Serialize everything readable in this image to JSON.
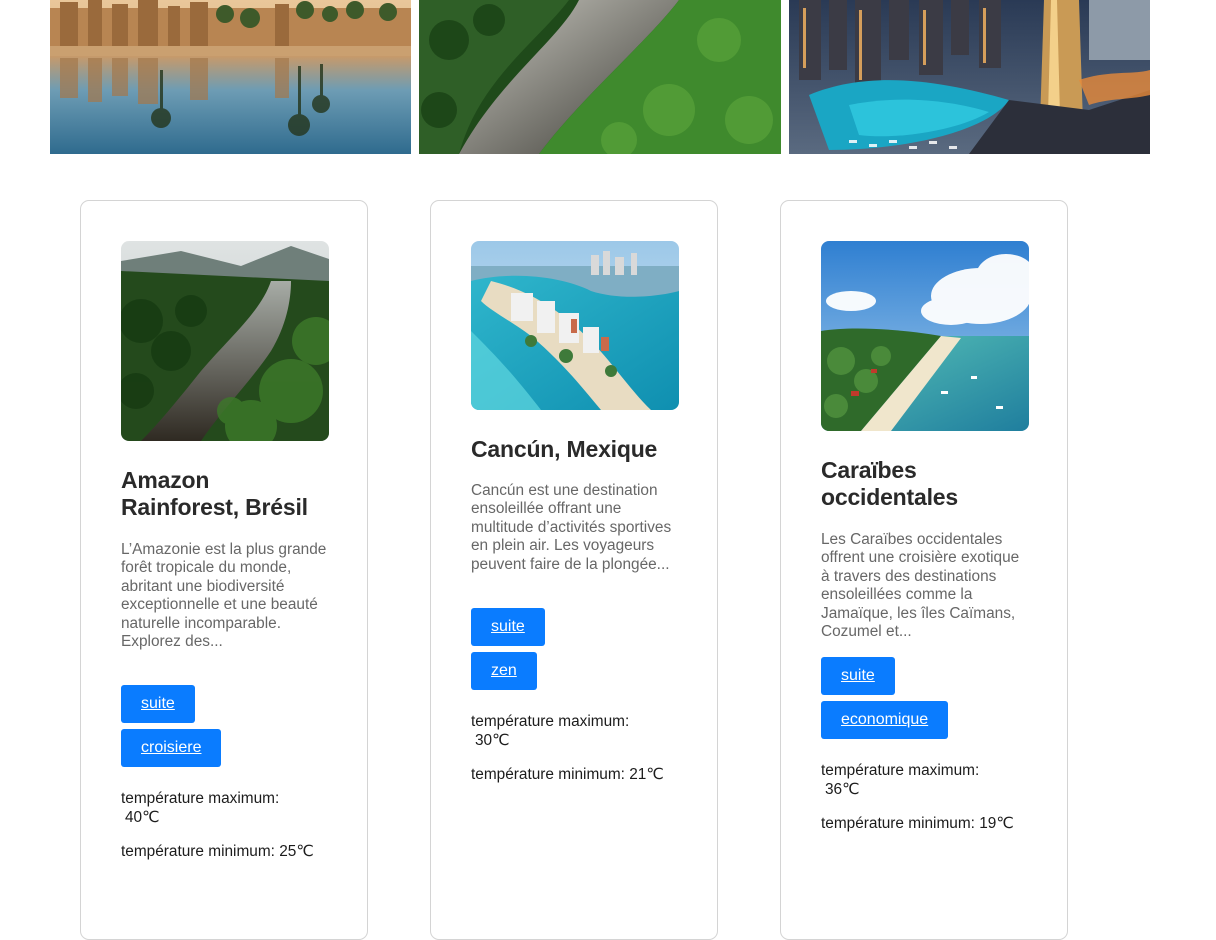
{
  "gallery": [
    {
      "name": "Karnak temple reflection"
    },
    {
      "name": "Amazon river aerial"
    },
    {
      "name": "Dubai marina night"
    }
  ],
  "cards": [
    {
      "title": "Amazon Rainforest, Brésil",
      "description": "L’Amazonie est la plus grande forêt tropicale du monde, abritant une biodiversité exceptionnelle et une beauté naturelle incomparable. Explorez des...",
      "buttons": [
        "suite",
        "croisiere"
      ],
      "temp_max_label": "température maximum:",
      "temp_max_value": "40℃",
      "temp_min": "température minimum: 25℃"
    },
    {
      "title": "Cancún, Mexique",
      "description": "Cancún est une destination ensoleillée offrant une multitude d’activités sportives en plein air. Les voyageurs peuvent faire de la plongée...",
      "buttons": [
        "suite",
        "zen"
      ],
      "temp_max_label": "température maximum:",
      "temp_max_value": "30℃",
      "temp_min": "température minimum: 21℃"
    },
    {
      "title": "Caraïbes occidentales",
      "description": "Les Caraïbes occidentales offrent une croisière exotique à travers des destinations ensoleillées comme la Jamaïque, les îles Caïmans, Cozumel et...",
      "buttons": [
        "suite",
        "economique"
      ],
      "temp_max_label": "température maximum:",
      "temp_max_value": "36℃",
      "temp_min": "température minimum: 19℃"
    }
  ]
}
